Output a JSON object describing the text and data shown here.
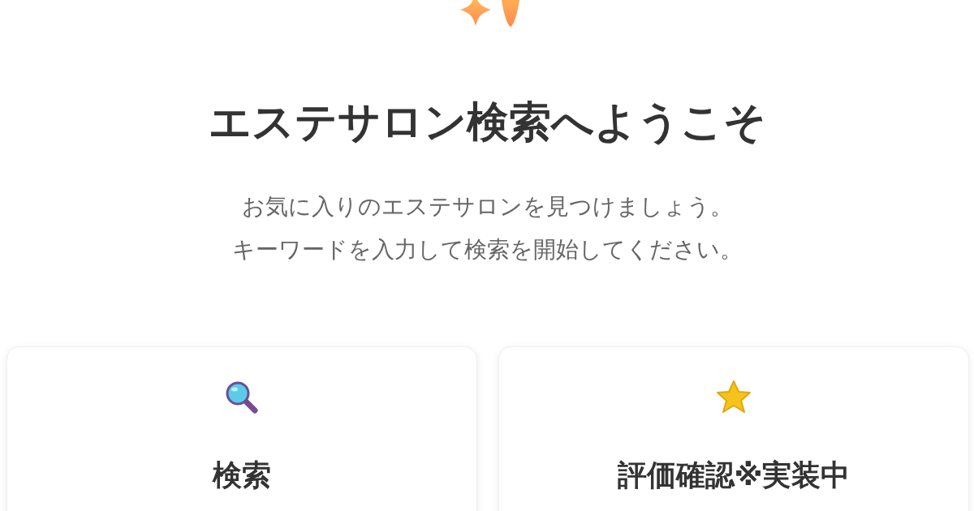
{
  "hero": {
    "title": "エステサロン検索へようこそ",
    "subtitle_lines": [
      "お気に入りのエステサロンを見つけましょう。",
      "キーワードを入力して検索を開始してください。"
    ]
  },
  "cards": [
    {
      "kind": "search",
      "title": "検索"
    },
    {
      "kind": "rating",
      "title": "評価確認※実装中"
    }
  ]
}
